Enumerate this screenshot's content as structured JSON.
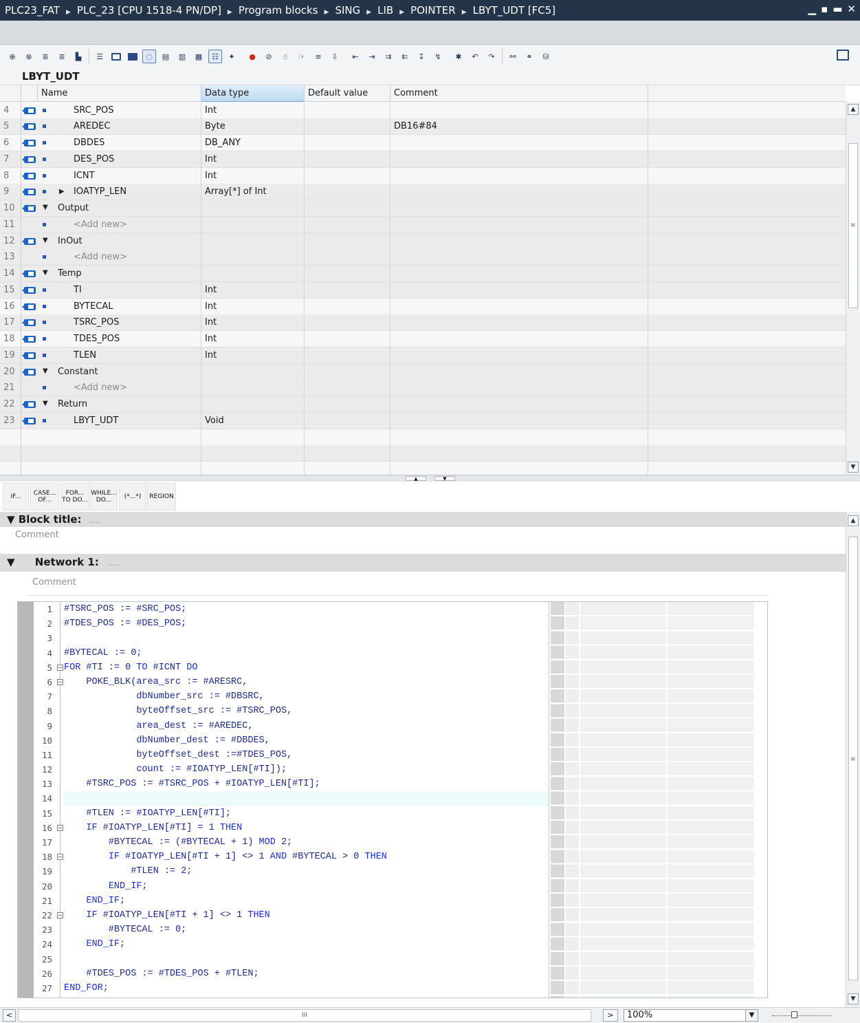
{
  "window": {
    "breadcrumb": [
      "PLC23_FAT",
      "PLC_23 [CPU 1518-4 PN/DP]",
      "Program blocks",
      "SING",
      "LIB",
      "POINTER",
      "LBYT_UDT [FC5]"
    ],
    "controls": [
      "minimize-icon",
      "restore-icon",
      "float-icon",
      "close-icon"
    ]
  },
  "editor": {
    "block_name": "LBYT_UDT",
    "columns": {
      "name": "Name",
      "data_type": "Data type",
      "default_value": "Default value",
      "comment": "Comment"
    },
    "rows": [
      {
        "num": "4",
        "level": 2,
        "name": "SRC_POS",
        "type": "Int",
        "comment": "",
        "section": false,
        "expander": ""
      },
      {
        "num": "5",
        "level": 2,
        "name": "AREDEC",
        "type": "Byte",
        "comment": "DB16#84",
        "section": false,
        "expander": ""
      },
      {
        "num": "6",
        "level": 2,
        "name": "DBDES",
        "type": "DB_ANY",
        "comment": "",
        "section": false,
        "expander": ""
      },
      {
        "num": "7",
        "level": 2,
        "name": "DES_POS",
        "type": "Int",
        "comment": "",
        "section": false,
        "expander": ""
      },
      {
        "num": "8",
        "level": 2,
        "name": "ICNT",
        "type": "Int",
        "comment": "",
        "section": false,
        "expander": ""
      },
      {
        "num": "9",
        "level": 2,
        "name": "IOATYP_LEN",
        "type": "Array[*] of Int",
        "comment": "",
        "section": false,
        "expander": "collapsed"
      },
      {
        "num": "10",
        "level": 1,
        "name": "Output",
        "type": "",
        "comment": "",
        "section": true,
        "expander": "expanded"
      },
      {
        "num": "11",
        "level": 2,
        "name": "<Add new>",
        "type": "",
        "comment": "",
        "section": false,
        "expander": "",
        "addnew": true
      },
      {
        "num": "12",
        "level": 1,
        "name": "InOut",
        "type": "",
        "comment": "",
        "section": true,
        "expander": "expanded"
      },
      {
        "num": "13",
        "level": 2,
        "name": "<Add new>",
        "type": "",
        "comment": "",
        "section": false,
        "expander": "",
        "addnew": true
      },
      {
        "num": "14",
        "level": 1,
        "name": "Temp",
        "type": "",
        "comment": "",
        "section": true,
        "expander": "expanded"
      },
      {
        "num": "15",
        "level": 2,
        "name": "TI",
        "type": "Int",
        "comment": "",
        "section": false,
        "expander": ""
      },
      {
        "num": "16",
        "level": 2,
        "name": "BYTECAL",
        "type": "Int",
        "comment": "",
        "section": false,
        "expander": ""
      },
      {
        "num": "17",
        "level": 2,
        "name": "TSRC_POS",
        "type": "Int",
        "comment": "",
        "section": false,
        "expander": ""
      },
      {
        "num": "18",
        "level": 2,
        "name": "TDES_POS",
        "type": "Int",
        "comment": "",
        "section": false,
        "expander": ""
      },
      {
        "num": "19",
        "level": 2,
        "name": "TLEN",
        "type": "Int",
        "comment": "",
        "section": false,
        "expander": ""
      },
      {
        "num": "20",
        "level": 1,
        "name": "Constant",
        "type": "",
        "comment": "",
        "section": true,
        "expander": "expanded"
      },
      {
        "num": "21",
        "level": 2,
        "name": "<Add new>",
        "type": "",
        "comment": "",
        "section": false,
        "expander": "",
        "addnew": true
      },
      {
        "num": "22",
        "level": 1,
        "name": "Return",
        "type": "",
        "comment": "",
        "section": true,
        "expander": "expanded"
      },
      {
        "num": "23",
        "level": 2,
        "name": "LBYT_UDT",
        "type": "Void",
        "comment": "",
        "section": false,
        "expander": ""
      }
    ],
    "empty_rows": 3
  },
  "scl_templates": [
    {
      "line1": "IF...",
      "line2": ""
    },
    {
      "line1": "CASE...",
      "line2": "OF..."
    },
    {
      "line1": "FOR...",
      "line2": "TO DO..."
    },
    {
      "line1": "WHILE...",
      "line2": "DO..."
    },
    {
      "line1": "(*...*)",
      "line2": ""
    },
    {
      "line1": "REGION",
      "line2": ""
    }
  ],
  "block_title": {
    "label": "Block title:",
    "placeholder": ".....",
    "comment": "Comment"
  },
  "network": {
    "label": "Network 1:",
    "placeholder": ".....",
    "comment": "Comment"
  },
  "code": {
    "highlighted_line": 14,
    "fold_lines": [
      5,
      6,
      16,
      18,
      22
    ],
    "lines": [
      "#TSRC_POS := #SRC_POS;",
      "#TDES_POS := #DES_POS;",
      "",
      "#BYTECAL := 0;",
      "FOR #TI := 0 TO #ICNT DO",
      "    POKE_BLK(area_src := #ARESRC,",
      "             dbNumber_src := #DBSRC,",
      "             byteOffset_src := #TSRC_POS,",
      "             area_dest := #AREDEC,",
      "             dbNumber_dest := #DBDES,",
      "             byteOffset_dest :=#TDES_POS,",
      "             count := #IOATYP_LEN[#TI]);",
      "    #TSRC_POS := #TSRC_POS + #IOATYP_LEN[#TI];",
      "",
      "    #TLEN := #IOATYP_LEN[#TI];",
      "    IF #IOATYP_LEN[#TI] = 1 THEN",
      "        #BYTECAL := (#BYTECAL + 1) MOD 2;",
      "        IF #IOATYP_LEN[#TI + 1] <> 1 AND #BYTECAL > 0 THEN",
      "            #TLEN := 2;",
      "        END_IF;",
      "    END_IF;",
      "    IF #IOATYP_LEN[#TI + 1] <> 1 THEN",
      "        #BYTECAL := 0;",
      "    END_IF;",
      "",
      "    #TDES_POS := #TDES_POS + #TLEN;",
      "END_FOR;"
    ]
  },
  "statusbar": {
    "zoom": "100%",
    "scroll_grip": "III"
  }
}
